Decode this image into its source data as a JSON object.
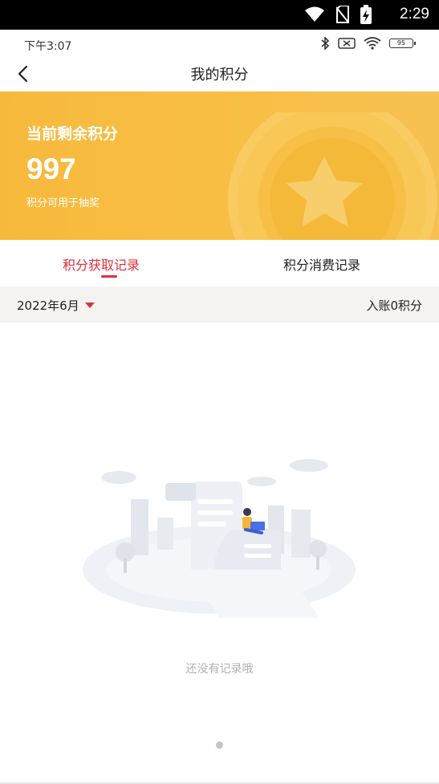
{
  "system_bar": {
    "time": "2:29"
  },
  "inner_status_bar": {
    "time": "下午3:07",
    "battery": "95"
  },
  "nav": {
    "title": "我的积分"
  },
  "points_banner": {
    "label": "当前剩余积分",
    "value": "997",
    "hint": "积分可用于抽奖"
  },
  "tabs": [
    {
      "label": "积分获取记录",
      "active": true
    },
    {
      "label": "积分消费记录",
      "active": false
    }
  ],
  "filter": {
    "month": "2022年6月",
    "income": "入账0积分"
  },
  "empty_state": {
    "message": "还没有记录哦"
  },
  "colors": {
    "accent": "#e0303a",
    "banner": "#f7b93c"
  }
}
